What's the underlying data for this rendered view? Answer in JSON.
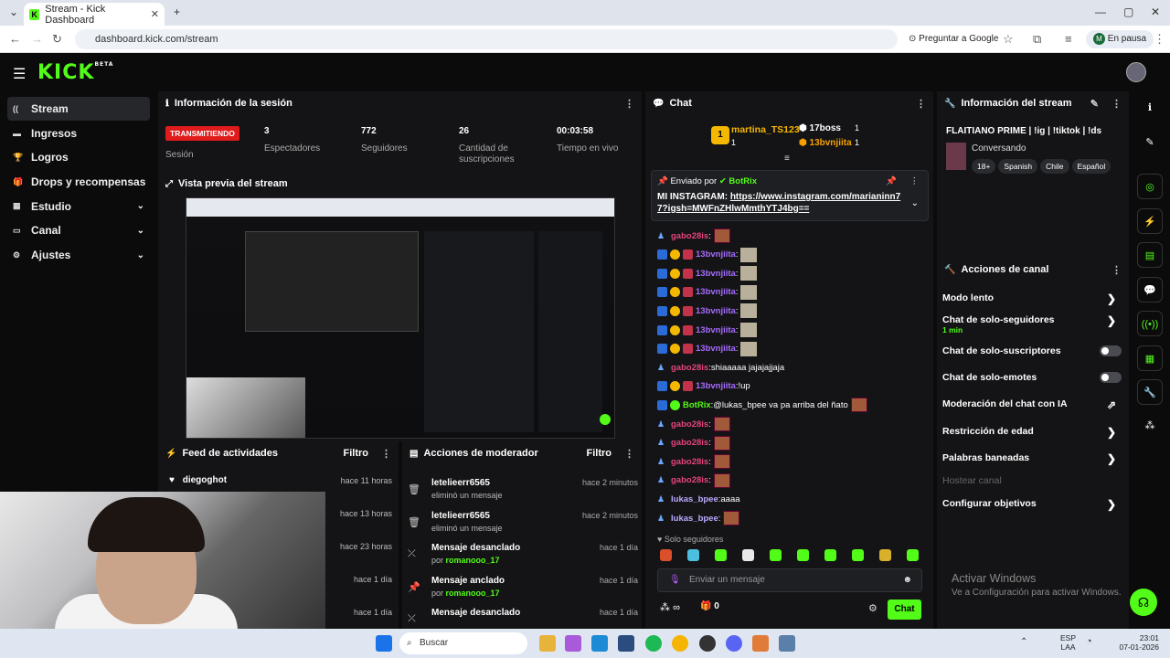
{
  "browser": {
    "tab_title": "Stream - Kick Dashboard",
    "url": "dashboard.kick.com/stream",
    "ask_google": "Preguntar a Google",
    "profile": "En pausa",
    "profile_initial": "M"
  },
  "app": {
    "logo": "KICK",
    "logo_sup": "BETA",
    "sidebar": [
      {
        "label": "Stream",
        "icon": "broadcast-icon",
        "active": true
      },
      {
        "label": "Ingresos",
        "icon": "card-icon"
      },
      {
        "label": "Logros",
        "icon": "trophy-icon"
      },
      {
        "label": "Drops y recompensas",
        "icon": "gift-icon"
      },
      {
        "label": "Estudio",
        "icon": "grid-icon",
        "chevron": true
      },
      {
        "label": "Canal",
        "icon": "monitor-icon",
        "chevron": true
      },
      {
        "label": "Ajustes",
        "icon": "gear-icon",
        "chevron": true
      }
    ]
  },
  "session": {
    "title": "Información de la sesión",
    "live_badge": "TRANSMITIENDO",
    "session_label": "Sesión",
    "stats": [
      {
        "value": "3",
        "label": "Espectadores"
      },
      {
        "value": "772",
        "label": "Seguidores"
      },
      {
        "value": "26",
        "label": "Cantidad de suscripciones"
      },
      {
        "value": "00:03:58",
        "label": "Tiempo en vivo"
      }
    ]
  },
  "preview": {
    "title": "Vista previa del stream"
  },
  "feed": {
    "title": "Feed de actividades",
    "filter": "Filtro",
    "rows": [
      {
        "name": "diegoghot",
        "time": "hace 11 horas"
      },
      {
        "name": "",
        "time": "hace 13 horas"
      },
      {
        "name": "",
        "time": "hace 23 horas"
      },
      {
        "name": "",
        "time": "hace 1 día"
      },
      {
        "name": "",
        "time": "hace 1 día"
      }
    ]
  },
  "modactions": {
    "title": "Acciones de moderador",
    "filter": "Filtro",
    "rows": [
      {
        "name": "letelieerr6565",
        "sub": "eliminó un mensaje",
        "by": "",
        "time": "hace 2 minutos",
        "icon": "trash-icon"
      },
      {
        "name": "letelieerr6565",
        "sub": "eliminó un mensaje",
        "by": "",
        "time": "hace 2 minutos",
        "icon": "trash-icon"
      },
      {
        "name": "Mensaje desanclado",
        "sub": "por ",
        "by": "romanooo_17",
        "time": "hace 1 día",
        "icon": "unpin-icon"
      },
      {
        "name": "Mensaje anclado",
        "sub": "por ",
        "by": "romanooo_17",
        "time": "hace 1 día",
        "icon": "pin-icon"
      },
      {
        "name": "Mensaje desanclado",
        "sub": "",
        "by": "",
        "time": "hace 1 día",
        "icon": "unpin-icon"
      }
    ]
  },
  "chat": {
    "title": "Chat",
    "leaderboard": {
      "first": "martina_TS123",
      "first_count": "1",
      "second": "17boss",
      "second_count": "1",
      "third": "13bvnjiita",
      "third_count": "1",
      "rank": "1",
      "sub_count": "1"
    },
    "pinned": {
      "sent_by": "Enviado por",
      "author": "BotRix",
      "text": "MI INSTAGRAM: ",
      "link": "https://www.instagram.com/marianinn77?igsh=MWFnZHlwMmthYTJ4bg=="
    },
    "messages": [
      {
        "user": "gabo28is",
        "color": "#e4447d",
        "text": "",
        "emote": true
      },
      {
        "user": "13bvnjiita",
        "color": "#a66cff",
        "text": "",
        "emote2": true,
        "badges": true
      },
      {
        "user": "13bvnjiita",
        "color": "#a66cff",
        "text": "",
        "emote2": true,
        "badges": true
      },
      {
        "user": "13bvnjiita",
        "color": "#a66cff",
        "text": "",
        "emote2": true,
        "badges": true
      },
      {
        "user": "13bvnjiita",
        "color": "#a66cff",
        "text": "",
        "emote2": true,
        "badges": true
      },
      {
        "user": "13bvnjiita",
        "color": "#a66cff",
        "text": "",
        "emote2": true,
        "badges": true
      },
      {
        "user": "13bvnjiita",
        "color": "#a66cff",
        "text": "",
        "emote2": true,
        "badges": true
      },
      {
        "user": "gabo28is",
        "color": "#e4447d",
        "text": " shiaaaaa jajajajjaja"
      },
      {
        "user": "13bvnjiita",
        "color": "#a66cff",
        "text": " !up",
        "badges": true
      },
      {
        "user": "BotRix",
        "color": "#53fc18",
        "text": " @lukas_bpee va pa arriba del ñato",
        "emote": true,
        "bot": true
      },
      {
        "user": "gabo28is",
        "color": "#e4447d",
        "text": "",
        "emote": true
      },
      {
        "user": "gabo28is",
        "color": "#e4447d",
        "text": "",
        "emote": true
      },
      {
        "user": "gabo28is",
        "color": "#e4447d",
        "text": "",
        "emote": true
      },
      {
        "user": "gabo28is",
        "color": "#e4447d",
        "text": "",
        "emote": true
      },
      {
        "user": "lukas_bpee",
        "color": "#bcaaff",
        "text": " aaaa"
      },
      {
        "user": "lukas_bpee",
        "color": "#bcaaff",
        "text": "",
        "emote": true
      }
    ],
    "followers_only": "Solo seguidores",
    "input_placeholder": "Enviar un mensaje",
    "infinity": "∞",
    "gift_count": "0",
    "send": "Chat"
  },
  "streaminfo": {
    "title": "Información del stream",
    "stream_title": "FLAITIANO PRIME | !ig | !tiktok | !ds",
    "category": "Conversando",
    "tags": [
      "18+",
      "Spanish",
      "Chile",
      "Español"
    ]
  },
  "channel_actions": {
    "title": "Acciones de canal",
    "items": [
      {
        "label": "Modo lento",
        "type": "chevron"
      },
      {
        "label": "Chat de solo-seguidores",
        "sub": "1 min",
        "type": "chevron"
      },
      {
        "label": "Chat de solo-suscriptores",
        "type": "toggle"
      },
      {
        "label": "Chat de solo-emotes",
        "type": "toggle"
      },
      {
        "label": "Moderación del chat con IA",
        "type": "external"
      },
      {
        "label": "Restricción de edad",
        "type": "chevron"
      },
      {
        "label": "Palabras baneadas",
        "type": "chevron"
      },
      {
        "label": "Hostear canal",
        "type": "disabled"
      },
      {
        "label": "Configurar objetivos",
        "type": "chevron"
      }
    ]
  },
  "watermark": {
    "line1": "Activar Windows",
    "line2": "Ve a Configuración para activar Windows."
  },
  "taskbar": {
    "search": "Buscar",
    "lang": "ESP",
    "lang2": "LAA",
    "time": "23:01",
    "date": "07-01-2026"
  }
}
